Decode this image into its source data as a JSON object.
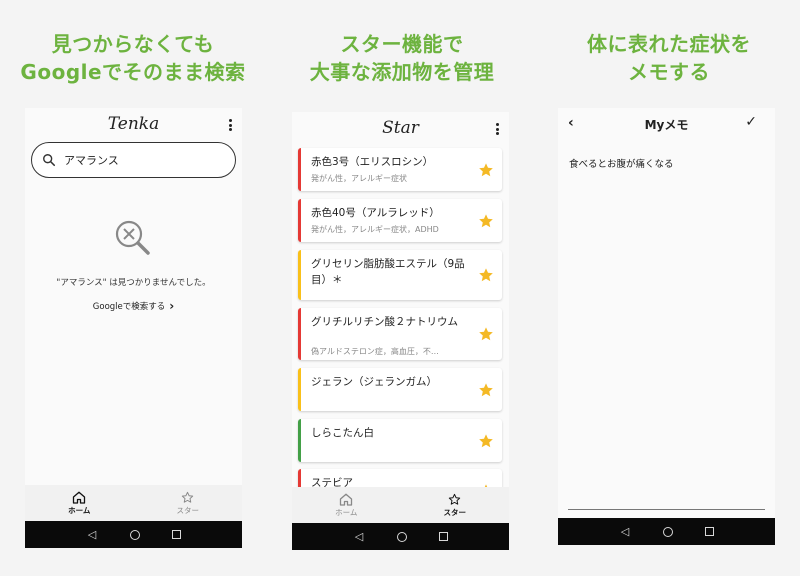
{
  "captions": [
    {
      "line1": "見つからなくても",
      "line2": "Googleでそのまま検索"
    },
    {
      "line1": "スター機能で",
      "line2": "大事な添加物を管理"
    },
    {
      "line1": "体に表れた症状を",
      "line2": "メモする"
    }
  ],
  "search_screen": {
    "app_title": "Tenka",
    "search_value": "アマランス",
    "not_found_text": "\"アマランス\" は見つかりませんでした。",
    "google_link": "Googleで検索する",
    "icons": {
      "search": "search-icon",
      "empty": "search-not-found-icon",
      "chevron": "chevron-right-icon",
      "menu": "kebab-menu-icon"
    }
  },
  "star_screen": {
    "app_title": "Star",
    "items": [
      {
        "name": "赤色3号（エリスロシン）",
        "desc": "発がん性，アレルギー症状",
        "color": "#e53935"
      },
      {
        "name": "赤色40号（アルラレッド）",
        "desc": "発がん性，アレルギー症状，ADHD",
        "color": "#e53935"
      },
      {
        "name": "グリセリン脂肪酸エステル（9品目）＊",
        "desc": "",
        "color": "#f9c01a"
      },
      {
        "name": "グリチルリチン酸２ナトリウム",
        "desc": "偽アルドステロン症，高血圧，不…",
        "color": "#e53935"
      },
      {
        "name": "ジェラン（ジェランガム）",
        "desc": "",
        "color": "#f9c01a"
      },
      {
        "name": "しらこたん白",
        "desc": "",
        "color": "#43a047"
      },
      {
        "name": "ステビア",
        "desc": "",
        "color": "#e53935"
      }
    ],
    "star_color": "#f4b925"
  },
  "bottom_nav": {
    "home": "ホーム",
    "star": "スター"
  },
  "memo_screen": {
    "title": "Myメモ",
    "body": "食べるとお腹が痛くなる",
    "icons": {
      "back": "back-icon",
      "save": "check-icon"
    }
  },
  "system_nav": {
    "back": "◁",
    "home": "○",
    "recents": "□"
  },
  "accent_color": "#6db33f"
}
